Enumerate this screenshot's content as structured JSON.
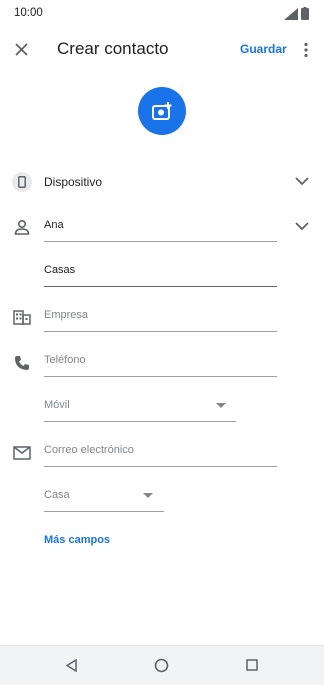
{
  "status_bar": {
    "time": "10:00"
  },
  "app_bar": {
    "title": "Crear contacto",
    "save_label": "Guardar"
  },
  "account": {
    "label": "Dispositivo"
  },
  "form": {
    "first_name": "Ana",
    "last_name": "Casas",
    "company_placeholder": "Empresa",
    "phone_placeholder": "Teléfono",
    "phone_type": "Móvil",
    "email_placeholder": "Correo electrónico",
    "email_type": "Casa"
  },
  "more_fields_label": "Más campos",
  "colors": {
    "accent": "#1a73e8",
    "text": "#202124",
    "hint": "#80868b"
  },
  "icons": [
    "close-icon",
    "more-vert-icon",
    "add-photo-icon",
    "phone-device-icon",
    "person-icon",
    "business-icon",
    "call-icon",
    "email-icon",
    "chevron-down-icon",
    "back-nav-icon",
    "home-nav-icon",
    "recents-nav-icon"
  ]
}
